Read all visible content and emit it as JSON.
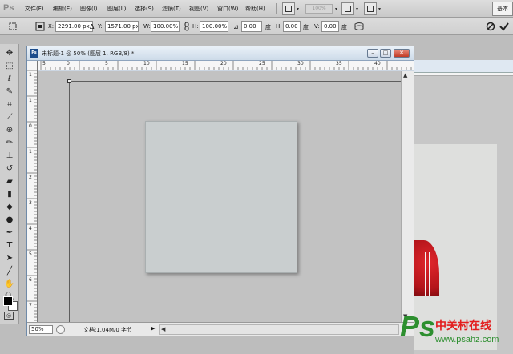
{
  "app": {
    "logo": "Ps"
  },
  "menu": [
    "文件(F)",
    "编辑(E)",
    "图像(I)",
    "图层(L)",
    "选择(S)",
    "滤镜(T)",
    "视图(V)",
    "窗口(W)",
    "帮助(H)"
  ],
  "menubar": {
    "zoom_placeholder": "100%",
    "workspace_label": "基本"
  },
  "options": {
    "x_label": "X:",
    "x_value": "2291.00 px",
    "y_label": "Y:",
    "y_value": "1571.00 px",
    "w_label": "W:",
    "w_value": "100.00%",
    "h_label": "H:",
    "h_value": "100.00%",
    "angle_value": "0.00",
    "angle_unit": "度",
    "hskew_label": "H:",
    "hskew_value": "0.00",
    "hskew_unit": "度",
    "vskew_label": "V:",
    "vskew_value": "0.00",
    "vskew_unit": "度"
  },
  "tools": [
    "move-tool",
    "marquee-tool",
    "lasso-tool",
    "quick-select-tool",
    "crop-tool",
    "eyedropper-tool",
    "healing-tool",
    "brush-tool",
    "clone-stamp-tool",
    "history-brush-tool",
    "eraser-tool",
    "gradient-tool",
    "blur-tool",
    "dodge-tool",
    "pen-tool",
    "type-tool",
    "path-select-tool",
    "shape-tool",
    "hand-tool",
    "zoom-tool"
  ],
  "document": {
    "title": "未标题-1 @ 50% (图层 1, RGB/8) *",
    "zoom": "50%",
    "info": "文档:1.04M/0 字节",
    "ruler_top": [
      "5",
      "0",
      "5",
      "10",
      "15",
      "20",
      "25",
      "30",
      "35",
      "40"
    ],
    "ruler_left": [
      "1",
      "1",
      "0",
      "1",
      "2",
      "3",
      "4",
      "5",
      "6",
      "7"
    ]
  },
  "watermark": {
    "logo": "Ps",
    "title": "中关村在线",
    "url": "www.psahz.com"
  },
  "colors": {
    "titlebar": "#dfe8f2",
    "canvas": "#c9cecf",
    "close": "#c23b25"
  }
}
